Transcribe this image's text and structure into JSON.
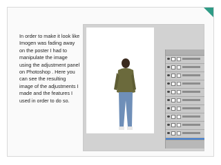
{
  "slide": {
    "body_text": "In order to make it look like Imogen was fading away on the poster I had to manipulate the image using the adjustment panel on Photoshop . Here you can see the resulting image of the adjustments I made and the features I used in order to do so.",
    "accent_color": "#2f9b86"
  },
  "screenshot": {
    "app": "Photoshop",
    "icon": "walking-figure-photo",
    "layers_panel": {
      "layer_count": 15,
      "selected_index": 14
    }
  }
}
